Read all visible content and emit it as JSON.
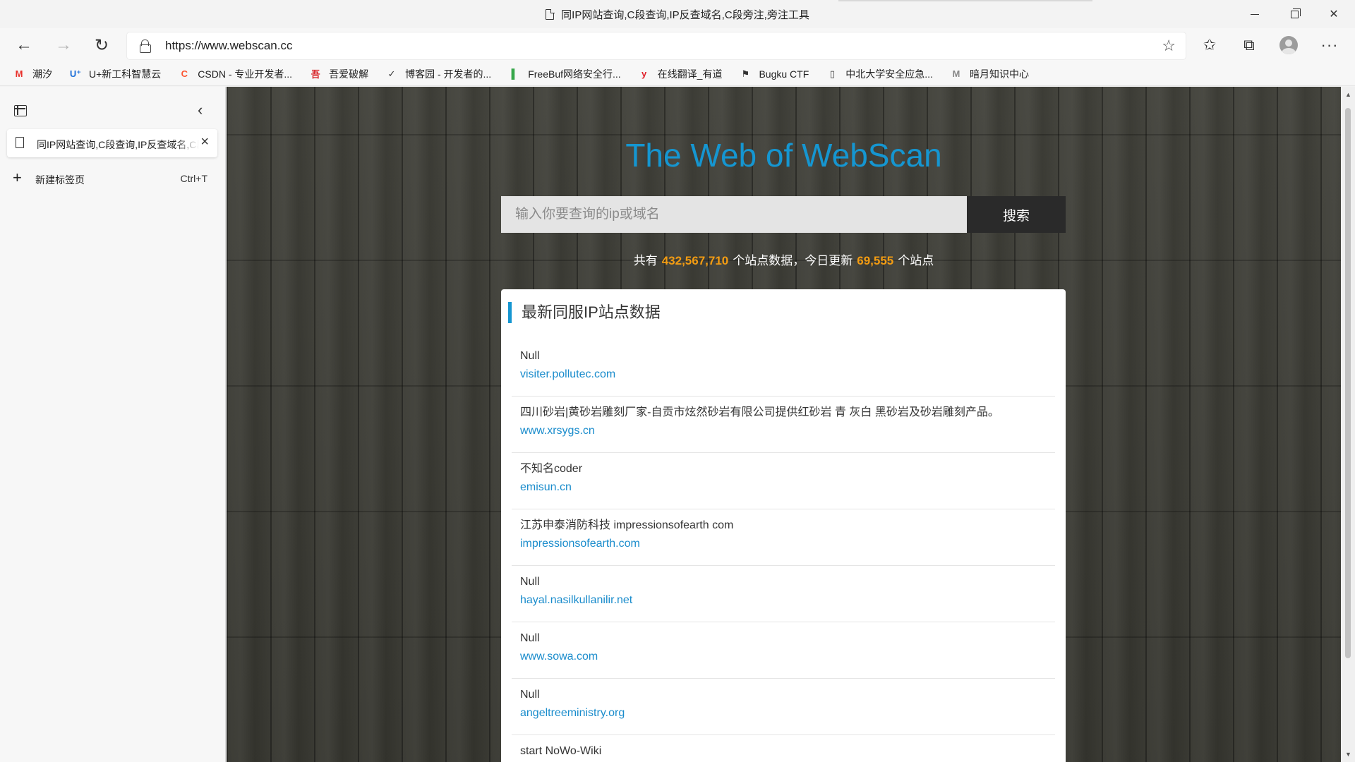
{
  "window": {
    "title": "同IP网站查询,C段查询,IP反查域名,C段旁注,旁注工具"
  },
  "nav": {
    "url": "https://www.webscan.cc"
  },
  "bookmarks": [
    {
      "label": "潮汐",
      "icon": "M",
      "color": "#e8322d"
    },
    {
      "label": "U+新工科智慧云",
      "icon": "U⁺",
      "color": "#1d6fd8"
    },
    {
      "label": "CSDN - 专业开发者...",
      "icon": "C",
      "color": "#fc5531"
    },
    {
      "label": "吾爱破解",
      "icon": "吾",
      "color": "#d8272c"
    },
    {
      "label": "博客园 - 开发者的...",
      "icon": "✓",
      "color": "#333333"
    },
    {
      "label": "FreeBuf网络安全行...",
      "icon": "▌",
      "color": "#37a74b"
    },
    {
      "label": "在线翻译_有道",
      "icon": "y",
      "color": "#e0212b"
    },
    {
      "label": "Bugku CTF",
      "icon": "⚑",
      "color": "#333333"
    },
    {
      "label": "中北大学安全应急...",
      "icon": "▯",
      "color": "#333333"
    },
    {
      "label": "暗月知识中心",
      "icon": "M",
      "color": "#888888"
    }
  ],
  "sidebar": {
    "tab_title": "同IP网站查询,C段查询,IP反查域名,C段旁注,旁注工具",
    "new_tab_label": "新建标签页",
    "new_tab_shortcut": "Ctrl+T"
  },
  "page": {
    "title": "The Web of WebScan",
    "search_placeholder": "输入你要查询的ip或域名",
    "search_button": "搜索",
    "stats": {
      "prefix": "共有",
      "total": "432,567,710",
      "middle": "个站点数据，今日更新",
      "today": "69,555",
      "suffix": "个站点"
    },
    "card_title": "最新同服IP站点数据",
    "sites": [
      {
        "title": "Null",
        "domain": "visiter.pollutec.com"
      },
      {
        "title": "四川砂岩|黄砂岩雕刻厂家-自贡市炫然砂岩有限公司提供红砂岩 青 灰白 黑砂岩及砂岩雕刻产品。",
        "domain": "www.xrsygs.cn"
      },
      {
        "title": "不知名coder",
        "domain": "emisun.cn"
      },
      {
        "title": "江苏申泰消防科技 impressionsofearth com",
        "domain": "impressionsofearth.com"
      },
      {
        "title": "Null",
        "domain": "hayal.nasilkullanilir.net"
      },
      {
        "title": "Null",
        "domain": "www.sowa.com"
      },
      {
        "title": "Null",
        "domain": "angeltreeministry.org"
      },
      {
        "title": "start NoWo-Wiki",
        "domain": ""
      }
    ]
  },
  "colors": {
    "accent": "#1596d1",
    "number": "#f39c12",
    "link": "#1a8ccc"
  }
}
